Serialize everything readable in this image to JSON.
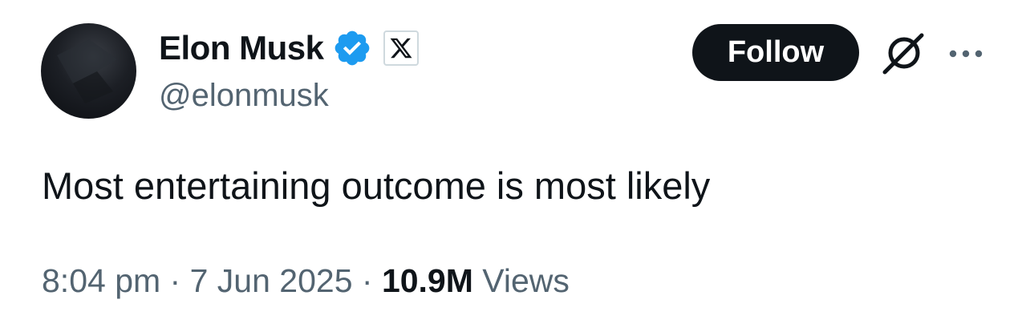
{
  "tweet": {
    "author": {
      "name": "Elon Musk",
      "handle": "@elonmusk",
      "verified_icon": "verified-badge-icon",
      "affiliate_icon": "x-logo-icon"
    },
    "actions": {
      "follow_label": "Follow",
      "grok_icon": "grok-icon",
      "more_icon": "more-options-icon"
    },
    "text": "Most entertaining outcome is most likely",
    "meta": {
      "time": "8:04 pm",
      "sep1": " · ",
      "date": "7 Jun 2025",
      "sep2": " · ",
      "views_count": "10.9M",
      "views_label": " Views"
    }
  },
  "colors": {
    "primary_text": "#0f1419",
    "secondary_text": "#536471",
    "verified_blue": "#1d9bf0",
    "button_bg": "#0f1419",
    "button_text": "#ffffff"
  }
}
